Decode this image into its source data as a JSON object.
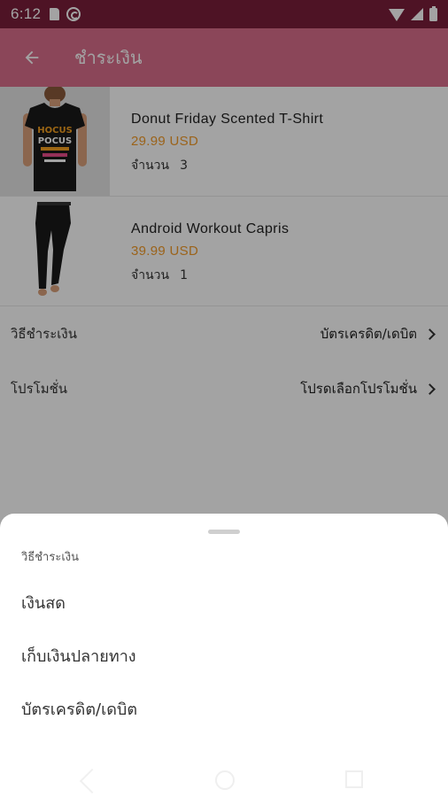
{
  "status_bar": {
    "time": "6:12",
    "icons": [
      "sd-card-icon",
      "sync-icon",
      "wifi-icon",
      "signal-icon",
      "battery-icon"
    ]
  },
  "app_bar": {
    "back_icon": "arrow-left-icon",
    "title": "ชำระเงิน"
  },
  "products": [
    {
      "name": "Donut Friday Scented T-Shirt",
      "price": "29.99 USD",
      "qty_label": "จำนวน",
      "qty": "3",
      "image": "black-tshirt-hocus-pocus"
    },
    {
      "name": "Android Workout Capris",
      "price": "39.99 USD",
      "qty_label": "จำนวน",
      "qty": "1",
      "image": "black-capris-leggings"
    }
  ],
  "settings": {
    "payment_label": "วิธีชำระเงิน",
    "payment_value": "บัตรเครดิต/เดบิต",
    "promo_label": "โปรโมชั่น",
    "promo_value": "โปรดเลือกโปรโมชั่น"
  },
  "sheet": {
    "title": "วิธีชำระเงิน",
    "options": [
      "เงินสด",
      "เก็บเงินปลายทาง",
      "บัตรเครดิต/เดบิต"
    ]
  },
  "colors": {
    "status_bar": "#7a1e3a",
    "app_bar": "#d96e8c",
    "price": "#f39c2a"
  }
}
